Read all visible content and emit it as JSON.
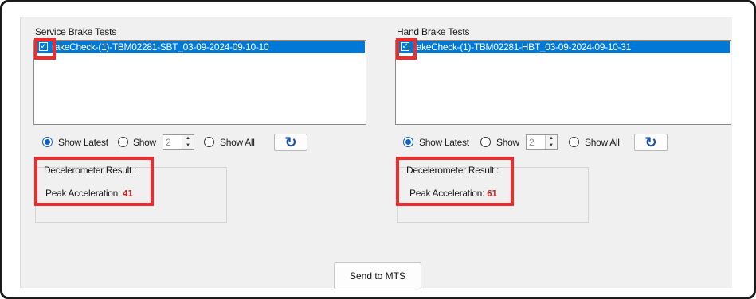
{
  "service": {
    "title": "Service Brake Tests",
    "item": "BrakeCheck-(1)-TBM02281-SBT_03-09-2024-09-10-10",
    "item_visible": "rakeCheck-(1)-TBM02281-SBT_03-09-2024-09-10-10",
    "show_latest": "Show Latest",
    "show": "Show",
    "count": "2",
    "show_all": "Show All",
    "result_title": "Decelerometer Result :",
    "peak_label": "Peak Acceleration:",
    "peak_value": "41"
  },
  "hand": {
    "title": "Hand Brake Tests",
    "item": "BrakeCheck-(1)-TBM02281-HBT_03-09-2024-09-10-31",
    "item_visible": "rakeCheck-(1)-TBM02281-HBT_03-09-2024-09-10-31",
    "show_latest": "Show Latest",
    "show": "Show",
    "count": "2",
    "show_all": "Show All",
    "result_title": "Decelerometer Result :",
    "peak_label": "Peak Acceleration:",
    "peak_value": "61"
  },
  "send_button": "Send to MTS",
  "colors": {
    "selection": "#0078d7",
    "highlight": "#ef2b2b",
    "peak_value": "#c0271f",
    "refresh_icon": "#1c4fa8"
  },
  "icons": {
    "refresh": "refresh-icon",
    "checkbox": "checkbox-checked-icon"
  }
}
